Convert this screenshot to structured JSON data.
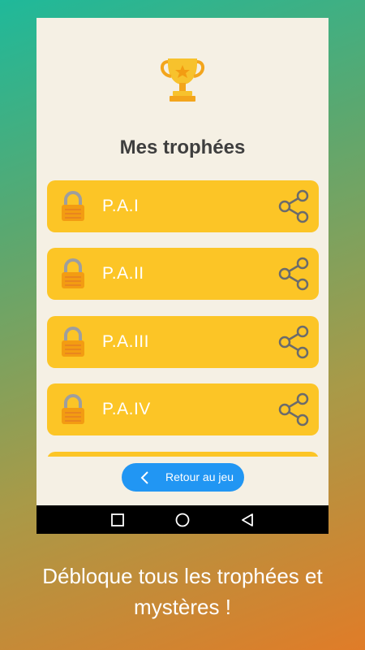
{
  "screen": {
    "title": "Mes trophées",
    "trophy_icon": "trophy-icon"
  },
  "trophies": [
    {
      "label": "P.A.I",
      "status": "locked"
    },
    {
      "label": "P.A.II",
      "status": "locked"
    },
    {
      "label": "P.A.III",
      "status": "locked"
    },
    {
      "label": "P.A.IV",
      "status": "locked"
    },
    {
      "label": "",
      "status": "locked"
    }
  ],
  "back_button": {
    "label": "Retour au jeu"
  },
  "caption": {
    "line1": "Débloque tous les trophées et",
    "line2": "mystères !"
  },
  "colors": {
    "item_bg": "#fcc526",
    "button_bg": "#2196f3",
    "screen_bg": "#f5f0e4"
  }
}
